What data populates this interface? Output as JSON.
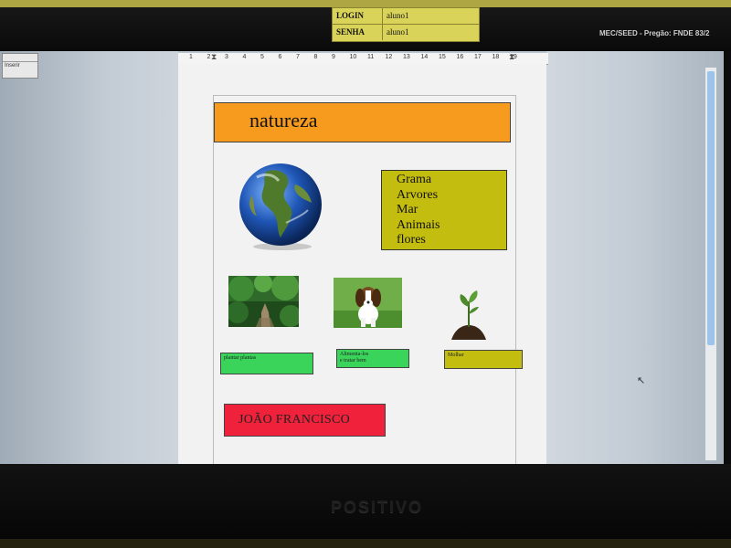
{
  "overlay": {
    "login_label": "LOGIN",
    "login_value": "aluno1",
    "senha_label": "SENHA",
    "senha_value": "aluno1",
    "brand_text": "MEC/SEED - Pregão: FNDE 83/2"
  },
  "toolbar": {
    "style_box": "Inserir"
  },
  "ruler": {
    "labels": [
      "1",
      "2",
      "3",
      "4",
      "5",
      "6",
      "7",
      "8",
      "9",
      "10",
      "11",
      "12",
      "13",
      "14",
      "15",
      "16",
      "17",
      "18",
      "19"
    ]
  },
  "document": {
    "title": "natureza",
    "list": [
      "Grama",
      "Arvores",
      "Mar",
      "Animais",
      "flores"
    ],
    "captions": {
      "caption1": "plantar plantas",
      "caption2_line1": "Alimenta-los",
      "caption2_line2": "e tratar bem",
      "caption3": "Molhar"
    },
    "author": "JOÃO FRANCISCO"
  },
  "monitor": {
    "brand": "POSITIVO"
  },
  "colors": {
    "title_bg": "#f79b1f",
    "list_bg": "#c3bd0f",
    "caption_green": "#3ad45a",
    "name_bg": "#f0213a"
  },
  "icons": {
    "earth": "earth-globe-image",
    "forest": "forest-path-image",
    "dog": "beagle-dog-image",
    "plant": "seedling-image",
    "cursor": "mouse-pointer-icon"
  }
}
